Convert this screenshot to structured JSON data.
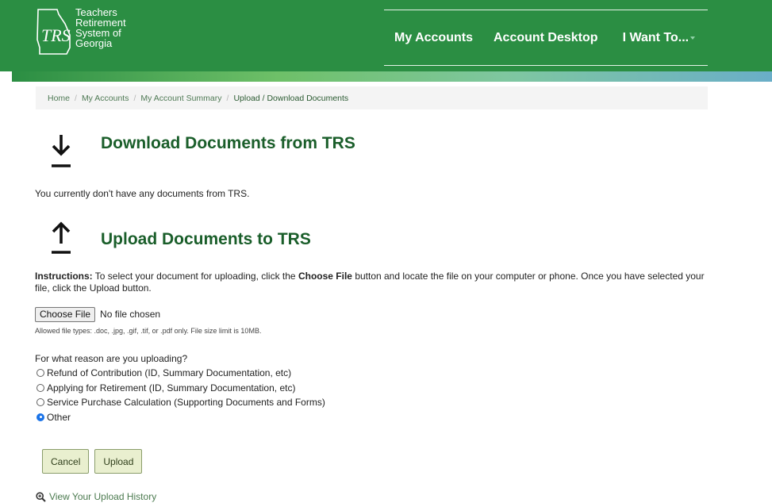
{
  "brand": {
    "logo_lines": [
      "Teachers",
      "Retirement",
      "System of",
      "Georgia"
    ],
    "logo_mark": "TRS",
    "colors": {
      "header_green": "#2b8e43",
      "title_green": "#1a5e2a",
      "link_green": "#4b7a4f"
    }
  },
  "nav": {
    "items": [
      {
        "label": "My Accounts"
      },
      {
        "label": "Account Desktop"
      },
      {
        "label": "I Want To...",
        "has_dropdown": true
      }
    ]
  },
  "breadcrumb": {
    "items": [
      "Home",
      "My Accounts",
      "My Account Summary"
    ],
    "current": "Upload / Download Documents"
  },
  "download": {
    "icon": "download-arrow-icon",
    "title": "Download Documents from TRS",
    "message": "You currently don't have any documents from TRS."
  },
  "upload": {
    "icon": "upload-arrow-icon",
    "title": "Upload Documents to TRS",
    "instructions_label": "Instructions:",
    "instructions_part1": "To select your document for uploading, click the",
    "instructions_bold": "Choose File",
    "instructions_part2": "button and locate the file on your computer or phone.   Once you have selected your file, click the Upload button.",
    "choose_file_label": "Choose File",
    "no_file_text": "No file chosen",
    "allowed_text": "Allowed file types: .doc, .jpg, .gif, .tif, or .pdf only. File size limit is 10MB.",
    "reason_question": "For what reason are you uploading?",
    "reasons": [
      {
        "label": "Refund of Contribution (ID, Summary Documentation, etc)",
        "checked": false
      },
      {
        "label": "Applying for Retirement (ID, Summary Documentation, etc)",
        "checked": false
      },
      {
        "label": "Service Purchase Calculation (Supporting Documents and Forms)",
        "checked": false
      },
      {
        "label": "Other",
        "checked": true
      }
    ],
    "cancel_label": "Cancel",
    "upload_label": "Upload",
    "history_icon": "zoom-in-icon",
    "history_label": "View Your Upload History"
  }
}
